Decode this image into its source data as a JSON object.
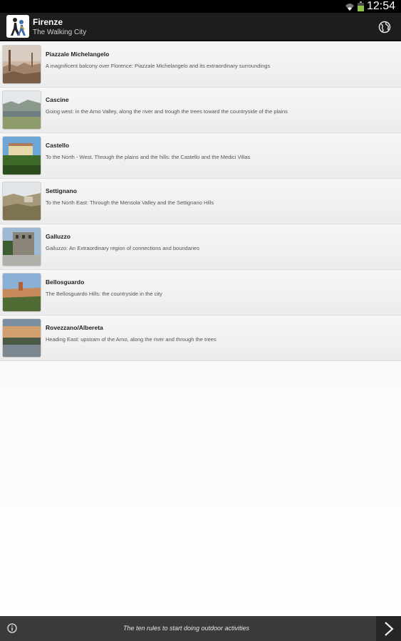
{
  "status_bar": {
    "time": "12:54"
  },
  "app_bar": {
    "title": "Firenze",
    "subtitle": "The Walking City"
  },
  "routes": [
    {
      "title": "Piazzale Michelangelo",
      "description": "A magnificent balcony over Florence: Piazzale Michelangelo and its extraordinary surroundings"
    },
    {
      "title": "Cascine",
      "description": "Going west: in the Arno Valley, along the river and trough the trees toward the countryside of the plains"
    },
    {
      "title": "Castello",
      "description": "To the North - West. Through the plains and the hills: the Castello and the Medici Villas"
    },
    {
      "title": "Settignano",
      "description": "To the North East: Through the Mensola Valley and the Settignano Hills"
    },
    {
      "title": "Galluzzo",
      "description": "Galluzzo: An Extraordinary region of connections and boundaries"
    },
    {
      "title": "Bellosguardo",
      "description": "The Bellosguardo Hills: the countryside in the city"
    },
    {
      "title": "Rovezzano/Albereta",
      "description": "Heading East: upstram of the Arno, along the river and through the trees"
    }
  ],
  "bottom_bar": {
    "text": "The ten rules to start doing outdoor activities"
  },
  "icons": {
    "logo": "walking-person-logo",
    "globe": "globe-icon",
    "info": "info-icon",
    "next": "chevron-right-icon"
  }
}
